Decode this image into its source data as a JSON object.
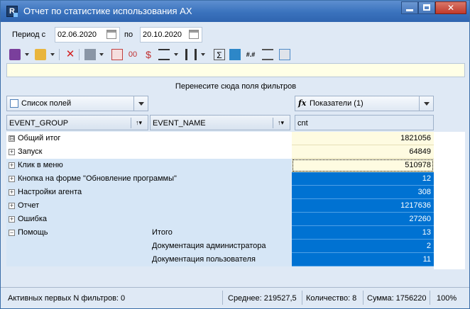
{
  "window": {
    "title": "Отчет по статистике использования АХ",
    "controls": {
      "minimize": "minimize-icon",
      "maximize": "maximize-icon",
      "close": "close-icon"
    }
  },
  "period": {
    "from_label": "Период с",
    "from_value": "02.06.2020",
    "to_label": "по",
    "to_value": "20.10.2020"
  },
  "toolbar": {
    "icons": [
      "save-icon",
      "open-folder-icon",
      "delete-icon",
      "export-icon",
      "grid-icon",
      "strike-icon",
      "currency-icon",
      "align-icon",
      "columns-icon",
      "sum-icon",
      "chart-icon",
      "number-format-icon",
      "list-icon",
      "info-icon"
    ]
  },
  "filter_area": {
    "hint": "Перенесите сюда поля фильтров"
  },
  "pivot": {
    "field_list": "Список полей",
    "measures": "Показатели (1)",
    "measure_col": "cnt",
    "row_headers": [
      "EVENT_GROUP",
      "EVENT_NAME"
    ],
    "rows": [
      {
        "label": "Общий итог",
        "sub": "",
        "value": "1821056",
        "expander": "⊟"
      },
      {
        "label": "Запуск",
        "sub": "",
        "value": "64849",
        "expander": "+"
      },
      {
        "label": "Клик в меню",
        "sub": "",
        "value": "510978",
        "expander": "+"
      },
      {
        "label": "Кнопка на форме \"Обновление программы\"",
        "sub": "",
        "value": "12",
        "expander": "+"
      },
      {
        "label": "Настройки агента",
        "sub": "",
        "value": "308",
        "expander": "+"
      },
      {
        "label": "Отчет",
        "sub": "",
        "value": "1217636",
        "expander": "+"
      },
      {
        "label": "Ошибка",
        "sub": "",
        "value": "27260",
        "expander": "+"
      },
      {
        "label": "Помощь",
        "sub": "Итого",
        "value": "13",
        "expander": "−"
      },
      {
        "label": "",
        "sub": "Документация администратора",
        "value": "2",
        "expander": ""
      },
      {
        "label": "",
        "sub": "Документация пользователя",
        "value": "11",
        "expander": ""
      }
    ]
  },
  "status": {
    "active_filters": "Активных первых N фильтров: 0",
    "average": "Среднее: 219527,5",
    "count": "Количество: 8",
    "sum": "Сумма: 1756220",
    "zoom": "100%"
  },
  "colors": {
    "title_bar": "#3a72bd",
    "selection": "#0072d2",
    "highlight": "#fefbe1",
    "row_alt": "#d6e6f6"
  }
}
